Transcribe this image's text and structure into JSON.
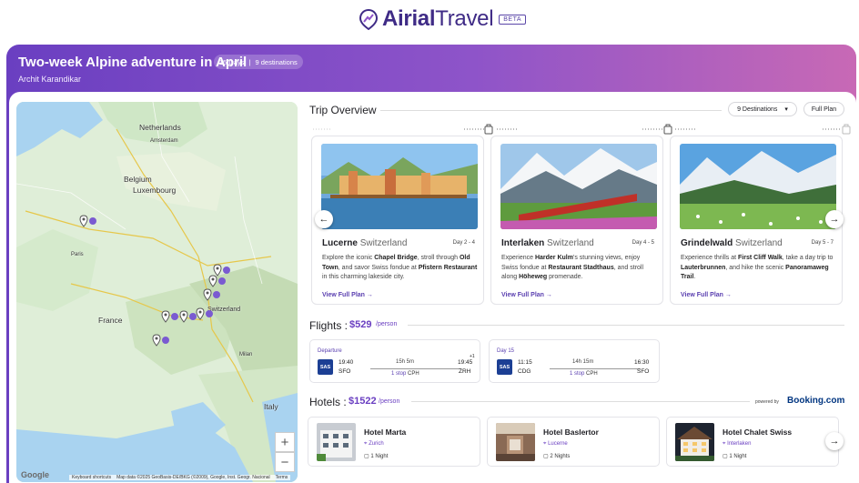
{
  "brand": {
    "name_bold": "Airial",
    "name_light": "Travel",
    "badge": "BETA"
  },
  "trip": {
    "title": "Two-week Alpine adventure in April",
    "days": "15 Days",
    "divider": "|",
    "destinations": "9 destinations",
    "author": "Archit Karandikar"
  },
  "map": {
    "labels": [
      "Netherlands",
      "Amsterdam",
      "Belgium",
      "Luxembourg",
      "Paris",
      "France",
      "Switzerland",
      "Milan",
      "Italy"
    ],
    "attribution": {
      "shortcuts": "Keyboard shortcuts",
      "data": "Map data ©2025 GeoBasis-DE/BKG (©2009), Google, Inst. Geogr. Nacional",
      "terms": "Terms"
    },
    "google": "Google",
    "zoom_in": "+",
    "zoom_out": "−"
  },
  "overview": {
    "title": "Trip Overview",
    "dest_select": "9 Destinations",
    "full_plan": "Full Plan",
    "cards": [
      {
        "city": "Lucerne",
        "country": "Switzerland",
        "days": "Day 2 - 4",
        "desc_html": "Explore the iconic <b>Chapel Bridge</b>, stroll through <b>Old Town</b>, and savor Swiss fondue at <b>Pfistern Restaurant</b> in this charming lakeside city.",
        "view": "View Full Plan"
      },
      {
        "city": "Interlaken",
        "country": "Switzerland",
        "days": "Day 4 - 5",
        "desc_html": "Experience <b>Harder Kulm</b>'s stunning views, enjoy Swiss fondue at <b>Restaurant Stadthaus</b>, and stroll along <b>Höheweg</b> promenade.",
        "view": "View Full Plan"
      },
      {
        "city": "Grindelwald",
        "country": "Switzerland",
        "days": "Day 5 - 7",
        "desc_html": "Experience thrills at <b>First Cliff Walk</b>, take a day trip to <b>Lauterbrunnen</b>, and hike the scenic <b>Panoramaweg Trail</b>.",
        "view": "View Full Plan"
      }
    ]
  },
  "flights": {
    "title": "Flights :",
    "price": "$529",
    "per": "/person",
    "items": [
      {
        "label": "Departure",
        "airline": "SAS",
        "dep_time": "19:40",
        "dep_code": "SFO",
        "duration": "15h 5m",
        "stops": "1 stop",
        "via": "CPH",
        "arr_time": "19:45",
        "arr_code": "ZRH",
        "plus": "+1"
      },
      {
        "label": "Day 15",
        "airline": "SAS",
        "dep_time": "11:15",
        "dep_code": "CDG",
        "duration": "14h 15m",
        "stops": "1 stop",
        "via": "CPH",
        "arr_time": "16:30",
        "arr_code": "SFO",
        "plus": ""
      }
    ]
  },
  "hotels": {
    "title": "Hotels :",
    "price": "$1522",
    "per": "/person",
    "powered": "powered by",
    "booking": "Booking.com",
    "items": [
      {
        "name": "Hotel Marta",
        "location": "Zurich",
        "nights": "1 Night"
      },
      {
        "name": "Hotel Baslertor",
        "location": "Lucerne",
        "nights": "2 Nights"
      },
      {
        "name": "Hotel Chalet Swiss",
        "location": "Interlaken",
        "nights": "1 Night"
      }
    ]
  },
  "colors": {
    "accent": "#6a3fc1",
    "banner_start": "#6a3fc1",
    "banner_end": "#c869b5",
    "booking": "#003580",
    "sas": "#1c3f94"
  }
}
